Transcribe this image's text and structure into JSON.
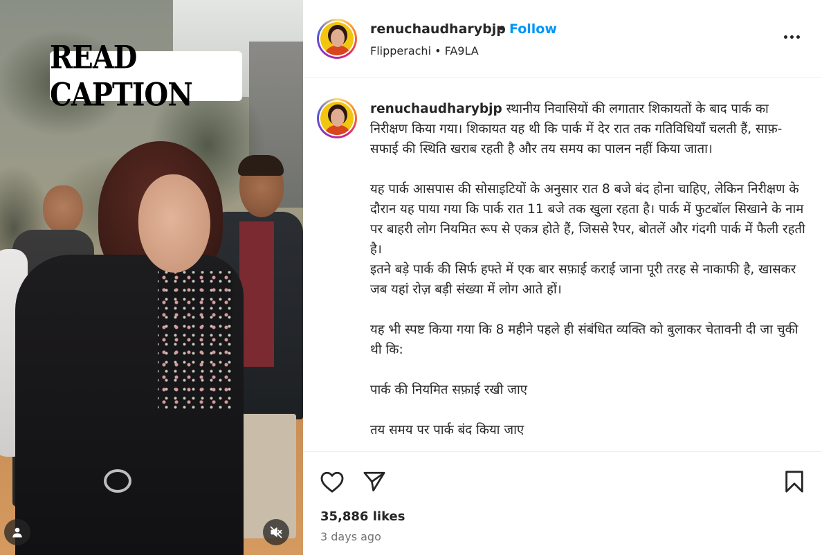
{
  "media": {
    "overlay_text": "READ CAPTION",
    "tag_button_icon": "person-tag-icon",
    "mute_button_icon": "speaker-muted-icon"
  },
  "header": {
    "username": "renuchaudharybjp",
    "separator": "•",
    "follow_label": "Follow",
    "subtitle": "Flipperachi • FA9LA",
    "more_icon": "more-options-icon"
  },
  "caption": {
    "username": "renuchaudharybjp",
    "paragraphs": [
      "स्थानीय निवासियों की लगातार शिकायतों के बाद पार्क का निरीक्षण किया गया। शिकायत यह थी कि पार्क में देर रात तक गतिविधियाँ चलती हैं, साफ़-सफाई की स्थिति खराब रहती है और तय समय का पालन नहीं किया जाता।",
      "यह पार्क आसपास की सोसाइटियों के अनुसार रात 8 बजे बंद होना चाहिए, लेकिन निरीक्षण के दौरान यह पाया गया कि पार्क रात 11 बजे तक खुला रहता है। पार्क में फुटबॉल सिखाने के नाम पर बाहरी लोग नियमित रूप से एकत्र होते हैं, जिससे रैपर, बोतलें और गंदगी पार्क में फैली रहती है।",
      "इतने बड़े पार्क की सिर्फ हफ्ते में एक बार सफ़ाई कराई जाना पूरी तरह से नाकाफी है, खासकर जब यहां रोज़ बड़ी संख्या में लोग आते हों।",
      "यह भी स्पष्ट किया गया कि 8 महीने पहले ही संबंधित व्यक्ति को बुलाकर चेतावनी दी जा चुकी थी कि:",
      "पार्क की नियमित सफ़ाई रखी जाए",
      "तय समय पर पार्क बंद किया जाए"
    ]
  },
  "actions": {
    "like_icon": "heart-icon",
    "share_icon": "paper-plane-icon",
    "save_icon": "bookmark-icon"
  },
  "stats": {
    "likes": "35,886 likes",
    "time_ago": "3 days ago"
  },
  "colors": {
    "follow_blue": "#0095f6",
    "text_primary": "#262626",
    "text_secondary": "#737373"
  }
}
